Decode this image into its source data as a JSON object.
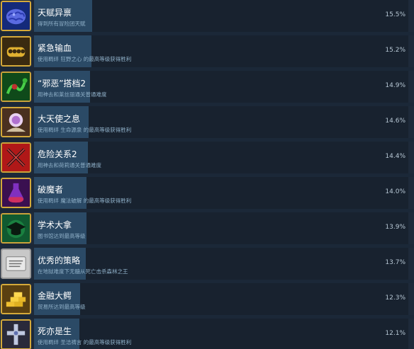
{
  "achievements": [
    {
      "name": "天赋异禀",
      "desc": "得到所有冒险团天赋",
      "percent": "15.5%",
      "progress": 15.5,
      "icon": "brain-icon"
    },
    {
      "name": "紧急输血",
      "desc": "使用羁绊 狂野之心 的最高等级获得胜利",
      "percent": "15.2%",
      "progress": 15.2,
      "icon": "brass-knuckles-icon"
    },
    {
      "name": "“邪恶”搭档2",
      "desc": "用神去和莱丝丽通关普通难度",
      "percent": "14.9%",
      "progress": 14.9,
      "icon": "serpent-icon"
    },
    {
      "name": "大天使之息",
      "desc": "使用羁绊 生命源泉 的最高等级获得胜利",
      "percent": "14.6%",
      "progress": 14.6,
      "icon": "angel-orb-icon"
    },
    {
      "name": "危险关系2",
      "desc": "用神去和荷莉通关普通难度",
      "percent": "14.4%",
      "progress": 14.4,
      "icon": "crossed-swords-icon"
    },
    {
      "name": "破魔者",
      "desc": "使用羁绊 魔法破解 的最高等级获得胜利",
      "percent": "14.0%",
      "progress": 14.0,
      "icon": "potion-icon"
    },
    {
      "name": "学术大拿",
      "desc": "图书馆达到最高等级",
      "percent": "13.9%",
      "progress": 13.9,
      "icon": "graduation-cap-icon"
    },
    {
      "name": "优秀的策略",
      "desc": "在地狱难度下无髓从死亡击杀森林之王",
      "percent": "13.7%",
      "progress": 13.7,
      "icon": "scroll-icon"
    },
    {
      "name": "金融大鳄",
      "desc": "贸易所达到最高等级",
      "percent": "12.3%",
      "progress": 12.3,
      "icon": "gold-bars-icon"
    },
    {
      "name": "死亦是生",
      "desc": "使用羁绊 圣洁祷言 的最高等级获得胜利",
      "percent": "12.1%",
      "progress": 12.1,
      "icon": "holy-cross-icon"
    }
  ]
}
